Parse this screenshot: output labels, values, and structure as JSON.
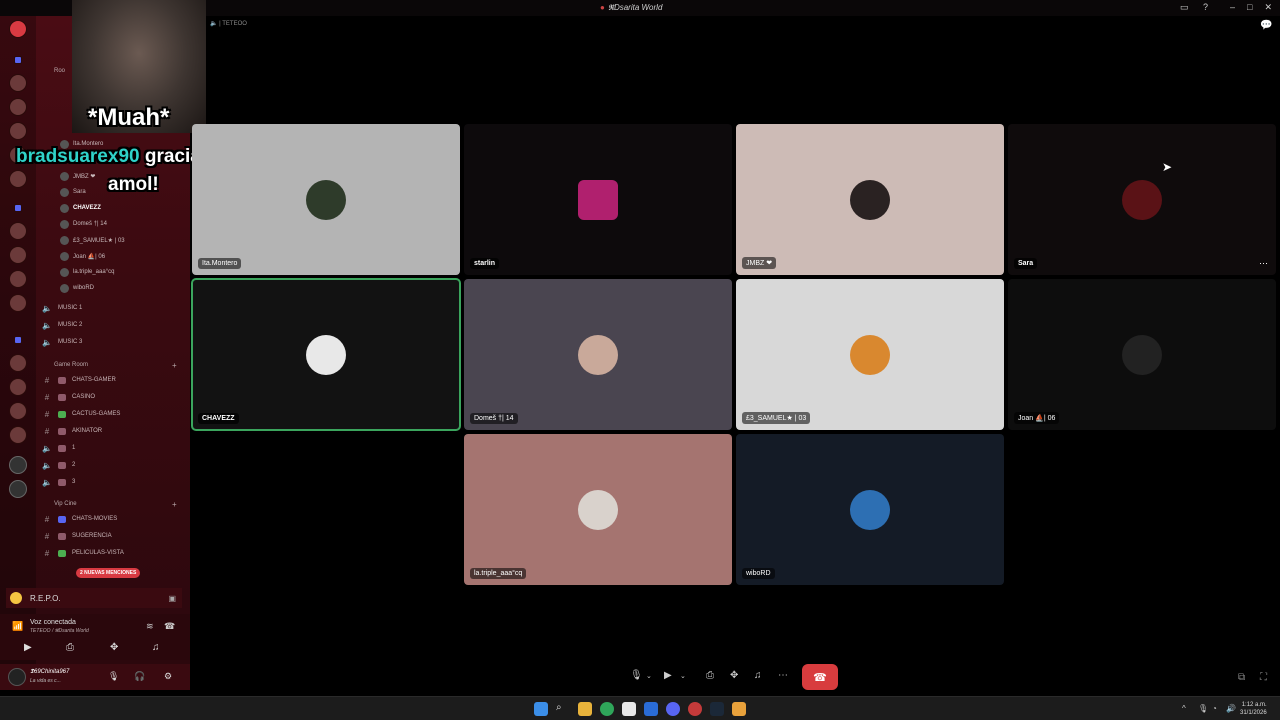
{
  "window": {
    "title": "𝕽Dsarita World"
  },
  "overlay": {
    "line1": "*Muah*",
    "user": "bradsuarex90",
    "line2_rest": "gracias",
    "line3": "amol!"
  },
  "channel_header": {
    "name": "TETEOO"
  },
  "sidebar": {
    "category_room": "Roo",
    "voice_users": [
      {
        "name": "Ita.Montero"
      },
      {
        "name": "JMBZ ❤"
      },
      {
        "name": "Sara"
      },
      {
        "name": "CHAVEZZ"
      },
      {
        "name": "Domeš †| 14"
      },
      {
        "name": "£3_SAMUEL★ | 03"
      },
      {
        "name": "Joan ⛵| 06"
      },
      {
        "name": "la.triple_aaa°cq"
      },
      {
        "name": "wiboRD"
      }
    ],
    "music_channels": [
      "MUSIC 1",
      "MUSIC 2",
      "MUSIC 3"
    ],
    "game_category": "Game Room",
    "game_channels": [
      "CHATS-GAMER",
      "CASINO",
      "CACTUS-GAMES",
      "AKINATOR",
      "1",
      "2",
      "3"
    ],
    "cine_category": "Vip Cine",
    "cine_channels": [
      "CHATS-MOVIES",
      "SUGERENCIA",
      "PELICULAS-VISTA"
    ],
    "mentions_badge": "2 NUEVAS MENCIONES",
    "status_text": "R.E.P.O."
  },
  "voice_panel": {
    "status": "Voz conectada",
    "location": "TETEOO / 𝕽Dsarita World"
  },
  "user_panel": {
    "name": "𝕯69Chinita967",
    "status": "La vida es c..."
  },
  "tiles": [
    {
      "name": "Ita.Montero",
      "bg": "#b4b4b4",
      "avatar": "#2e3b2a"
    },
    {
      "name": "starlin",
      "bg": "#0d0a0c",
      "avatar": "#b0206e"
    },
    {
      "name": "JMBZ ❤",
      "bg": "#cdbbb6",
      "avatar": "#2a2222"
    },
    {
      "name": "Sara",
      "bg": "#0f0b0c",
      "avatar": "#5a1216"
    },
    {
      "name": "CHAVEZZ",
      "bg": "#121212",
      "avatar": "#e8e8e8"
    },
    {
      "name": "Domeš †| 14",
      "bg": "#4a4550",
      "avatar": "#c9a99a"
    },
    {
      "name": "£3_SAMUEL★ | 03",
      "bg": "#d8d8d8",
      "avatar": "#d9882f"
    },
    {
      "name": "Joan ⛵| 06",
      "bg": "#0d0d0d",
      "avatar": "#222222"
    },
    {
      "name": "la.triple_aaa°cq",
      "bg": "#a57470",
      "avatar": "#d9d2cc"
    },
    {
      "name": "wiboRD",
      "bg": "#141b26",
      "avatar": "#2d6fb3"
    }
  ],
  "taskbar": {
    "time": "1:12 a.m.",
    "date": "31/1/2026"
  }
}
